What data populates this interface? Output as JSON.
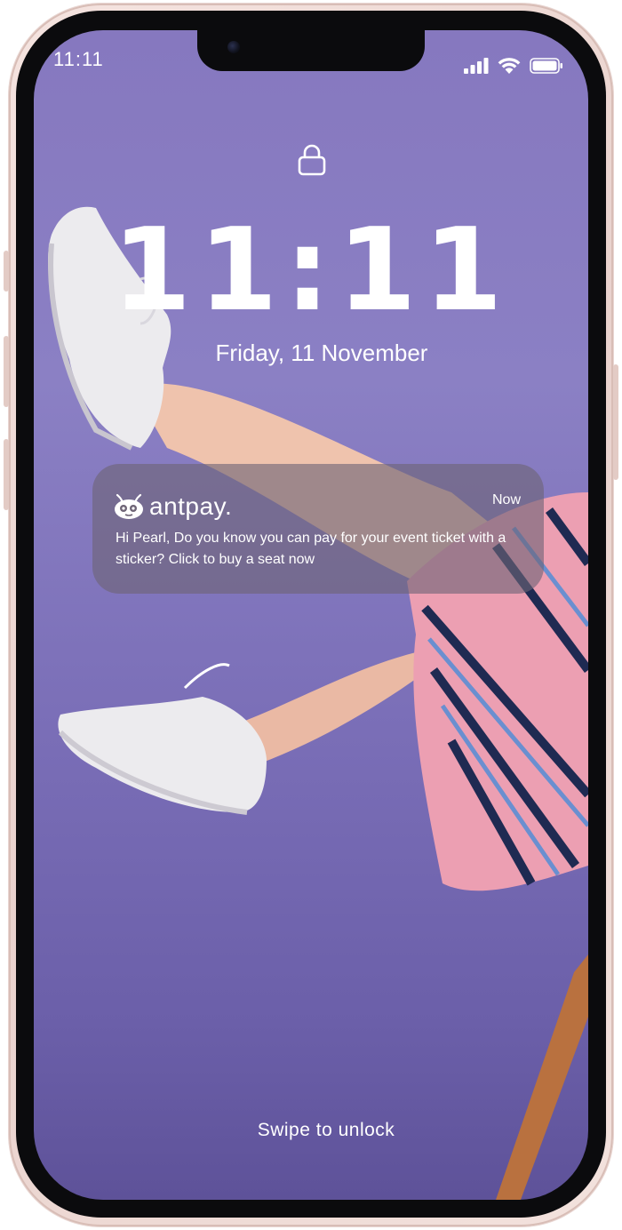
{
  "status_bar": {
    "time": "11:11",
    "signal_icon": "cellular-signal-icon",
    "wifi_icon": "wifi-icon",
    "battery_icon": "battery-icon"
  },
  "lock_screen": {
    "lock_icon": "padlock-icon",
    "time": "11:11",
    "date": "Friday, 11 November",
    "swipe_hint": "Swipe to unlock"
  },
  "notification": {
    "app_name": "antpay.",
    "app_icon": "antpay-logo-icon",
    "time": "Now",
    "message": "Hi Pearl, Do you know you can pay for your event ticket with a sticker? Click to buy a seat now"
  },
  "wallpaper": "woman-legs-white-sneakers-striped-skirt-photo",
  "colors": {
    "wallpaper_purple": "#8678bf",
    "phone_frame": "#f5e4e0",
    "notification_bg": "#6e6476",
    "text": "#ffffff"
  }
}
